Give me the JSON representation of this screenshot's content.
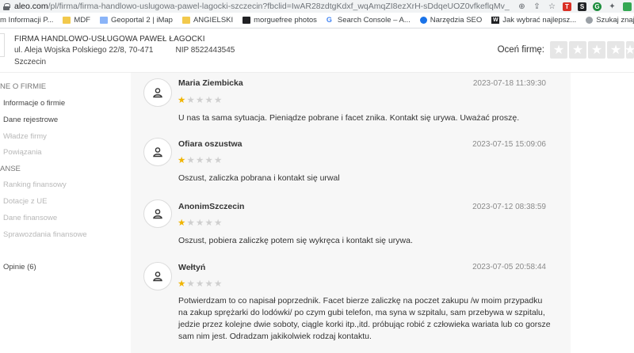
{
  "browser": {
    "url_host": "aleo.com",
    "url_path": "/pl/firma/firma-handlowo-uslugowa-pawel-lagocki-szczecin?fbclid=IwAR28zdtgKdxf_wqAmqZI8ezXrH-sDdqeUOZ0vfkeflqMv_Qf_i-e...",
    "bookmarks": [
      {
        "label": "m Informacji P...",
        "icon": "site-icon"
      },
      {
        "label": "MDF",
        "icon": "folder-icon"
      },
      {
        "label": "Geoportal 2 | iMap",
        "icon": "geoportal-icon"
      },
      {
        "label": "ANGIELSKI",
        "icon": "folder-icon"
      },
      {
        "label": "morguefree photos",
        "icon": "morguefree-icon"
      },
      {
        "label": "Search Console – A...",
        "icon": "google-icon"
      },
      {
        "label": "Narzędzia SEO",
        "icon": "globe-icon"
      },
      {
        "label": "Jak wybrać najlepsz...",
        "icon": "w-icon"
      },
      {
        "label": "Szukaj znajomych",
        "icon": "globe-icon"
      }
    ],
    "bookmarks_more": "»"
  },
  "company": {
    "name": "FIRMA HANDLOWO-USŁUGOWA PAWEŁ ŁAGOCKI",
    "address": "ul. Aleja Wojska Polskiego 22/8, 70-471",
    "nip": "NIP 8522443545",
    "city": "Szczecin",
    "rate_label": "Oceń firmę:"
  },
  "sidebar": {
    "section1": "NE O FIRMIE",
    "items1": [
      {
        "label": "Informacje o firmie",
        "enabled": true
      },
      {
        "label": "Dane rejestrowe",
        "enabled": true
      },
      {
        "label": "Władze firmy",
        "enabled": false
      },
      {
        "label": "Powiązania",
        "enabled": false
      }
    ],
    "section2": "ANSE",
    "items2": [
      {
        "label": "Ranking finansowy",
        "enabled": false
      },
      {
        "label": "Dotacje z UE",
        "enabled": false
      },
      {
        "label": "Dane finansowe",
        "enabled": false
      },
      {
        "label": "Sprawozdania finansowe",
        "enabled": false
      }
    ],
    "opinions": "Opinie (6)"
  },
  "reviews": [
    {
      "name": "Maria Ziembicka",
      "date": "2023-07-18 11:39:30",
      "rating": 1,
      "max_rating": 5,
      "text": "U nas ta sama sytuacja. Pieniądze pobrane i facet znika. Kontakt się urywa. Uważać proszę."
    },
    {
      "name": "Ofiara oszustwa",
      "date": "2023-07-15 15:09:06",
      "rating": 1,
      "max_rating": 5,
      "text": "Oszust, zaliczka pobrana i kontakt się urwal"
    },
    {
      "name": "AnonimSzczecin",
      "date": "2023-07-12 08:38:59",
      "rating": 1,
      "max_rating": 5,
      "text": "Oszust, pobiera zaliczkę potem się wykręca i kontakt się urywa."
    },
    {
      "name": "Wełtyń",
      "date": "2023-07-05 20:58:44",
      "rating": 1,
      "max_rating": 5,
      "text": "Potwierdzam to co napisał poprzednik. Facet bierze zaliczkę na poczet zakupu /w moim przypadku na zakup sprężarki do lodówki/ po czym gubi telefon, ma syna w szpitalu, sam przebywa w szpitalu, jedzie przez kolejne dwie soboty, ciągle korki itp.,itd. próbując robić z człowieka wariata lub co gorsze sam nim jest. Odradzam jakikolwiek rodzaj kontaktu."
    }
  ],
  "colors": {
    "star_full": "#f0b400",
    "star_empty": "#cfcfcf",
    "main_bg": "#f7f7f7"
  }
}
